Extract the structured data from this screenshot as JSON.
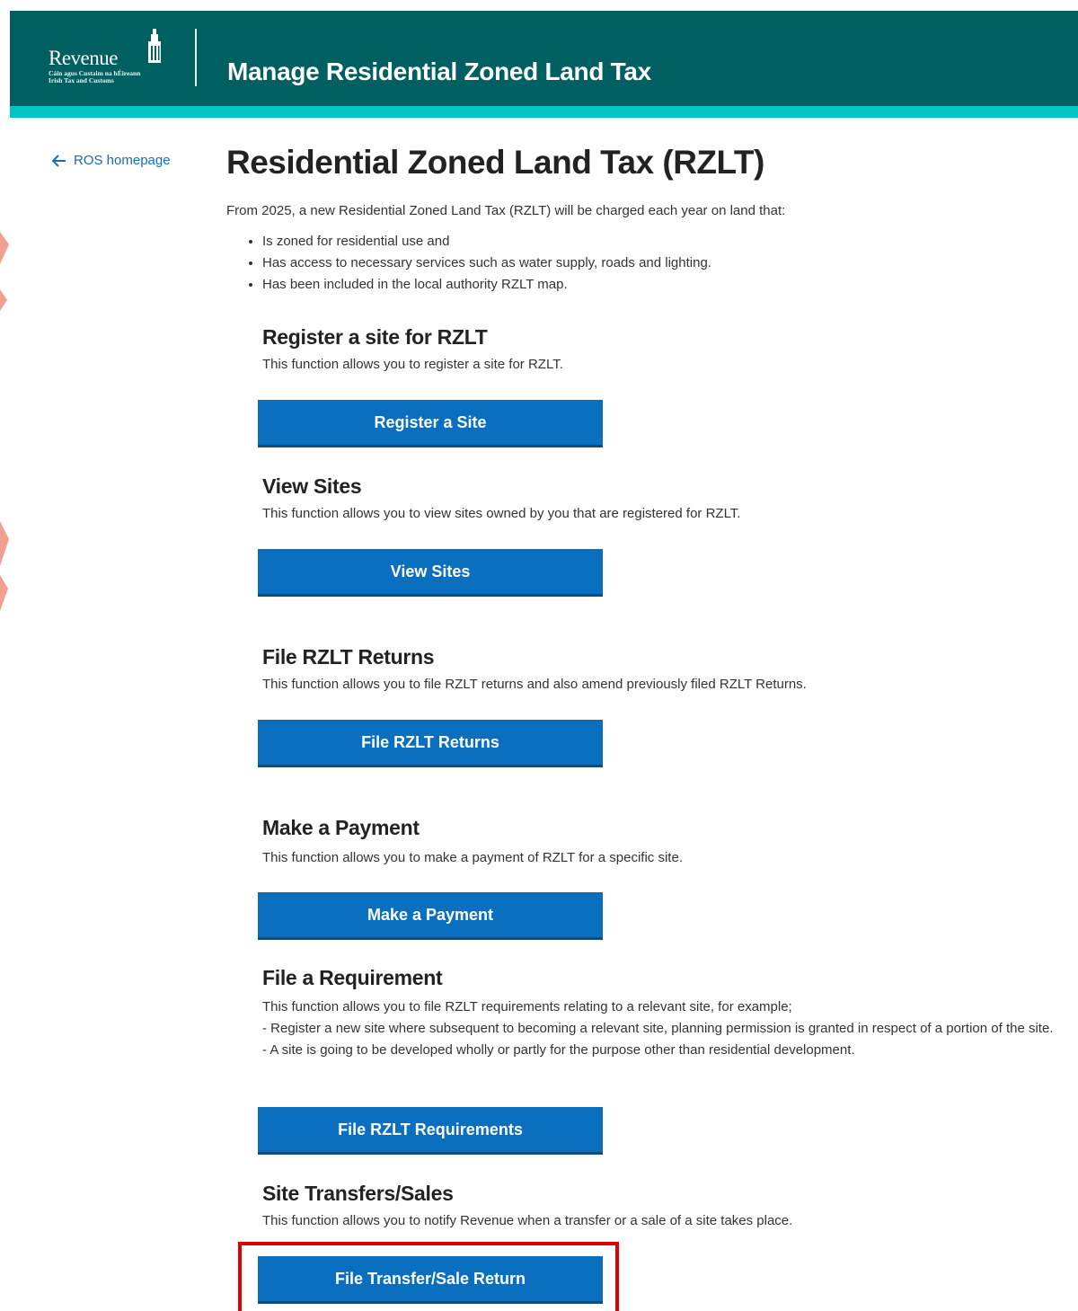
{
  "header": {
    "logo_text": "Revenue",
    "logo_subtext_line1": "Cáin agus Custaim na hÉireann",
    "logo_subtext_line2": "Irish Tax and Customs",
    "title": "Manage Residential Zoned Land Tax"
  },
  "nav": {
    "back_link": "ROS homepage"
  },
  "main": {
    "title": "Residential Zoned Land Tax (RZLT)",
    "intro": "From 2025, a new Residential Zoned Land Tax (RZLT) will be charged each year on land that:",
    "bullets": [
      "Is zoned for residential use and",
      "Has access to necessary services such as water supply, roads and lighting.",
      "Has been included in the local authority RZLT map."
    ],
    "sections": [
      {
        "title": "Register a site for RZLT",
        "description": "This function allows you to register a site for RZLT.",
        "button": "Register a Site"
      },
      {
        "title": "View Sites",
        "description": "This function allows you to view sites owned by you that are registered for RZLT.",
        "button": "View Sites"
      },
      {
        "title": "File RZLT Returns",
        "description": "This function allows you to file RZLT returns and also amend previously filed RZLT Returns.",
        "button": "File RZLT Returns"
      },
      {
        "title": "Make a Payment",
        "description": "This function allows you to make a payment of RZLT for a specific site.",
        "button": "Make a Payment"
      },
      {
        "title": "File a Requirement",
        "description": "This function allows you to file RZLT requirements relating to a relevant site, for example;",
        "description_lines": [
          "- Register a new site where subsequent to becoming a relevant site, planning permission is granted in respect of a portion of the site.",
          "- A site is going to be developed wholly or partly for the purpose other than residential development."
        ],
        "button": "File RZLT Requirements"
      },
      {
        "title": "Site Transfers/Sales",
        "description": "This function allows you to notify Revenue when a transfer or a sale of a site takes place.",
        "button": "File Transfer/Sale Return"
      }
    ]
  },
  "colors": {
    "header_bg": "#005f61",
    "header_stripe": "#00c4c0",
    "button_bg": "#0b6fc0",
    "link": "#1a6bb8",
    "highlight": "#e00000"
  },
  "icons": {
    "back": "arrow-left-icon",
    "logo": "harp-icon"
  }
}
